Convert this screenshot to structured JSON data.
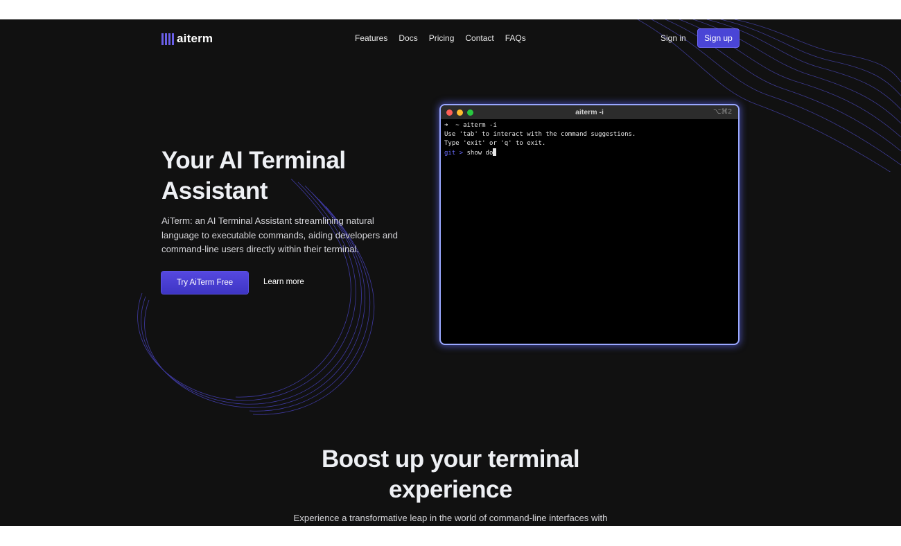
{
  "brand": {
    "logo_text": "aiterm",
    "accent_color": "#4a45d6"
  },
  "nav": {
    "items": [
      {
        "label": "Features"
      },
      {
        "label": "Docs"
      },
      {
        "label": "Pricing"
      },
      {
        "label": "Contact"
      },
      {
        "label": "FAQs"
      }
    ]
  },
  "auth": {
    "signin_label": "Sign in",
    "signup_label": "Sign up"
  },
  "hero": {
    "title": "Your AI Terminal Assistant",
    "description": "AiTerm: an AI Terminal Assistant streamlining natural language to executable commands, aiding developers and command-line users directly within their terminal.",
    "primary_button": "Try AiTerm Free",
    "secondary_button": "Learn more"
  },
  "terminal": {
    "title": "aiterm -i",
    "shortcut": "⌥⌘2",
    "lines": [
      "➜  ~ aiterm -i",
      "Use 'tab' to interact with the command suggestions.",
      "Type 'exit' or 'q' to exit."
    ],
    "prompt": "git > ",
    "input": "show do"
  },
  "section": {
    "title": "Boost up your terminal experience",
    "description": "Experience a transformative leap in the world of command-line interfaces with"
  }
}
